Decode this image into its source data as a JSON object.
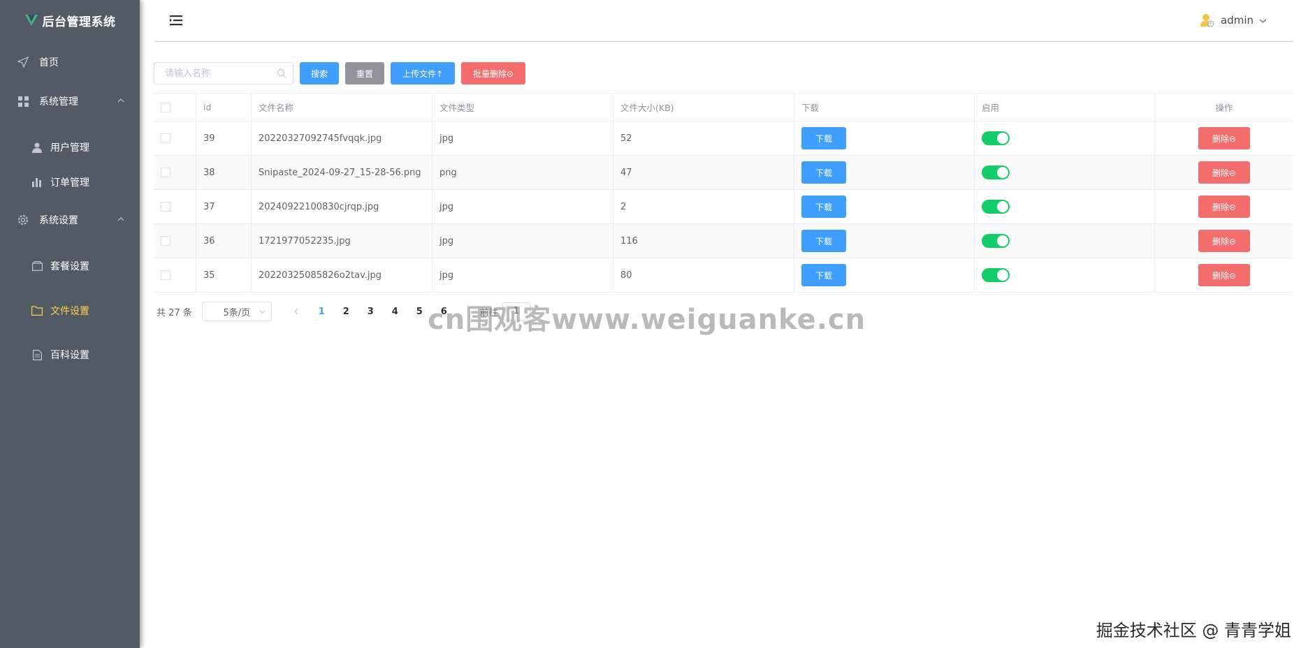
{
  "sidebar": {
    "logo_text": "后台管理系统",
    "items": [
      {
        "label": "首页",
        "icon": "send-icon"
      },
      {
        "label": "系统管理",
        "icon": "grid-icon"
      },
      {
        "label": "用户管理",
        "icon": "user-icon"
      },
      {
        "label": "订单管理",
        "icon": "bar-chart-icon"
      },
      {
        "label": "系统设置",
        "icon": "gear-icon"
      },
      {
        "label": "套餐设置",
        "icon": "box-icon"
      },
      {
        "label": "文件设置",
        "icon": "folder-icon",
        "active": true
      },
      {
        "label": "百科设置",
        "icon": "document-icon"
      }
    ],
    "bg_color": "#525a66",
    "active_color": "#ffd04b"
  },
  "header": {
    "username": "admin"
  },
  "toolbar": {
    "search_placeholder": "请输入名称",
    "search_label": "搜索",
    "reset_label": "重置",
    "upload_label": "上传文件↑",
    "batch_delete_label": "批量删除⊝"
  },
  "table": {
    "columns": [
      "id",
      "文件名称",
      "文件类型",
      "文件大小(KB)",
      "下载",
      "启用",
      "操作"
    ],
    "rows": [
      {
        "id": "39",
        "name": "20220327092745fvqqk.jpg",
        "type": "jpg",
        "size": "52",
        "enabled": true
      },
      {
        "id": "38",
        "name": "Snipaste_2024-09-27_15-28-56.png",
        "type": "png",
        "size": "47",
        "enabled": true
      },
      {
        "id": "37",
        "name": "20240922100830cjrqp.jpg",
        "type": "jpg",
        "size": "2",
        "enabled": true
      },
      {
        "id": "36",
        "name": "1721977052235.jpg",
        "type": "jpg",
        "size": "116",
        "enabled": true
      },
      {
        "id": "35",
        "name": "20220325085826o2tav.jpg",
        "type": "jpg",
        "size": "80",
        "enabled": true
      }
    ],
    "download_label": "下载",
    "delete_label": "删除⊝"
  },
  "pagination": {
    "total_text": "共 27 条",
    "page_size": "5条/页",
    "pages": [
      "1",
      "2",
      "3",
      "4",
      "5",
      "6"
    ],
    "current_page": "1",
    "goto_prefix": "前往",
    "goto_value": "1"
  },
  "overlay": {
    "watermark": "cn围观客www.weiguanke.cn",
    "credit": "掘金技术社区 @ 青青学姐"
  },
  "colors": {
    "primary": "#409eff",
    "danger": "#f56c6c",
    "info": "#909399",
    "success": "#13ce66"
  }
}
